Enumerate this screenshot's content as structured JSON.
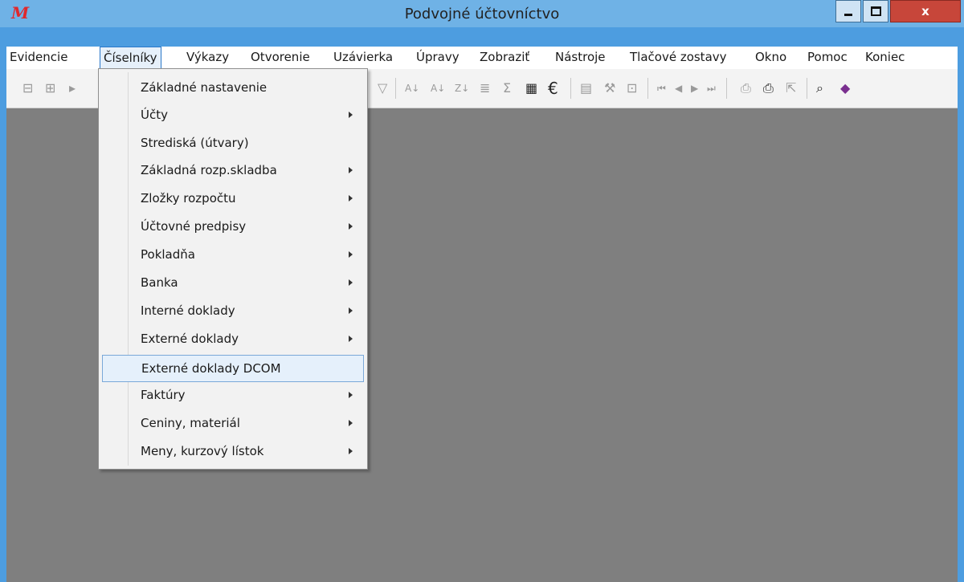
{
  "window": {
    "title": "Podvojné účtovníctvo",
    "logo": "M",
    "close_label": "x"
  },
  "menu": {
    "items": [
      "Evidencie",
      "Číselníky",
      "Výkazy",
      "Otvorenie",
      "Uzávierka",
      "Úpravy",
      "Zobraziť",
      "Nástroje",
      "Tlačové zostavy",
      "Okno",
      "Pomoc",
      "Koniec"
    ],
    "active": "Číselníky"
  },
  "toolbar": {
    "icons": [
      "nav-left-icon",
      "nav-right-icon",
      "filter-icon",
      "sort-asc-icon",
      "sort-asc-2-icon",
      "sort-desc-icon",
      "columns-icon",
      "sum-icon",
      "calculator-icon",
      "euro-icon",
      "document-icon",
      "tools-icon",
      "properties-icon",
      "first-record-icon",
      "prev-record-icon",
      "next-record-icon",
      "last-record-icon",
      "print-preview-icon",
      "print-icon",
      "export-icon",
      "search-icon",
      "book-icon"
    ],
    "euro_symbol": "€",
    "sum_symbol": "Σ"
  },
  "dropdown": {
    "items": [
      {
        "label": "Základné nastavenie",
        "submenu": false
      },
      {
        "label": "Účty",
        "submenu": true
      },
      {
        "label": "Strediská (útvary)",
        "submenu": false
      },
      {
        "label": "Základná rozp.skladba",
        "submenu": true
      },
      {
        "label": "Zložky rozpočtu",
        "submenu": true
      },
      {
        "label": "Účtovné predpisy",
        "submenu": true
      },
      {
        "label": "Pokladňa",
        "submenu": true
      },
      {
        "label": "Banka",
        "submenu": true
      },
      {
        "label": "Interné doklady",
        "submenu": true
      },
      {
        "label": "Externé doklady",
        "submenu": true
      },
      {
        "label": "Externé doklady DCOM",
        "submenu": false
      },
      {
        "label": "Faktúry",
        "submenu": true
      },
      {
        "label": "Ceniny, materiál",
        "submenu": true
      },
      {
        "label": "Meny, kurzový lístok",
        "submenu": true
      }
    ],
    "highlighted": "Externé doklady DCOM"
  },
  "colors": {
    "titlebar": "#6fb2e6",
    "workspace": "#7f7f7f",
    "close_button": "#c7463a",
    "highlight": "#e5f0fb"
  }
}
